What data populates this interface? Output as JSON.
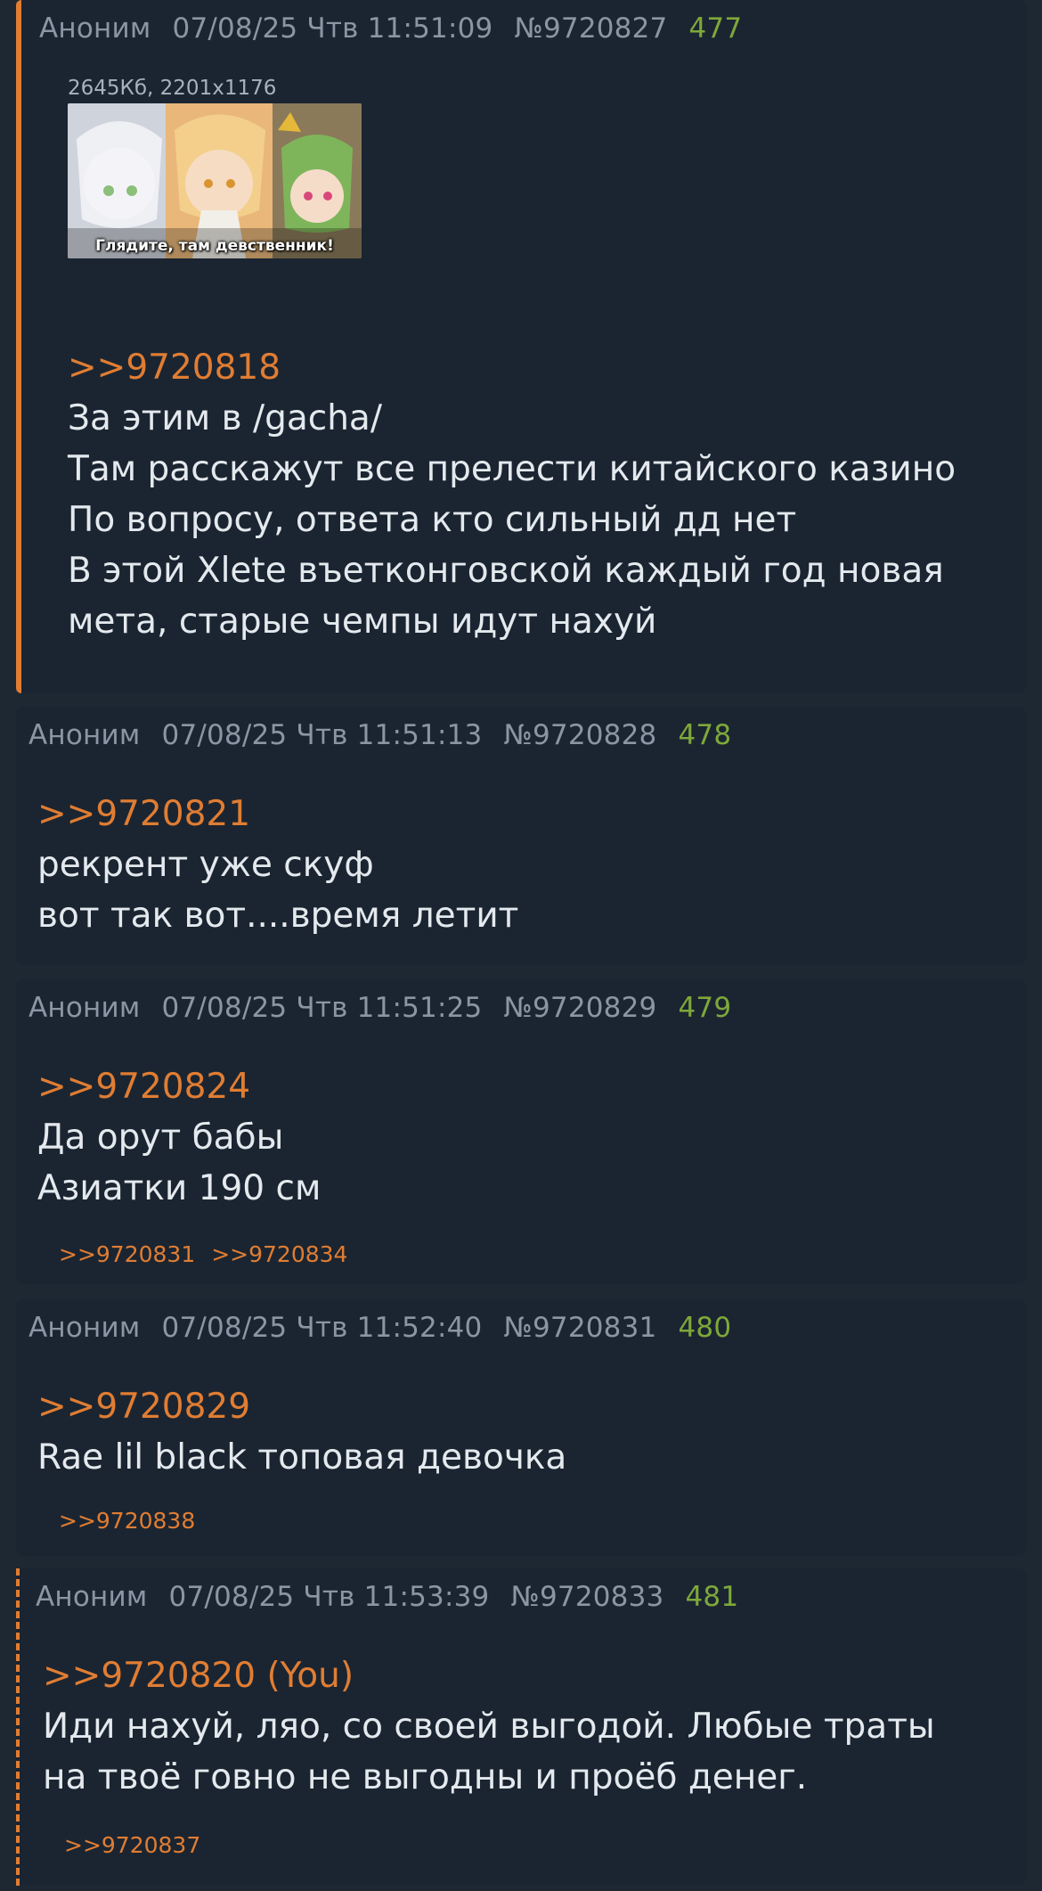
{
  "posts": [
    {
      "author": "Аноним",
      "date": "07/08/25 Чтв 11:51:09",
      "post_id": "№9720827",
      "ordinal": "477",
      "file": {
        "info": "2645Кб, 2201x1176",
        "caption": "Глядите, там девственник!"
      },
      "reply_to": ">>9720818",
      "lines": [
        "За этим в /gacha/",
        "Там расскажут все прелести китайского казино",
        "По вопросу, ответа кто сильный дд нет",
        "В этой Xlete въетконговской каждый год новая",
        "мета, старые чемпы идут нахуй"
      ]
    },
    {
      "author": "Аноним",
      "date": "07/08/25 Чтв 11:51:13",
      "post_id": "№9720828",
      "ordinal": "478",
      "reply_to": ">>9720821",
      "lines": [
        "рекрент уже скуф",
        "вот так вот....время летит"
      ]
    },
    {
      "author": "Аноним",
      "date": "07/08/25 Чтв 11:51:25",
      "post_id": "№9720829",
      "ordinal": "479",
      "reply_to": ">>9720824",
      "lines": [
        "Да орут бабы",
        "Азиатки 190 см"
      ],
      "backrefs": [
        ">>9720831",
        ">>9720834"
      ]
    },
    {
      "author": "Аноним",
      "date": "07/08/25 Чтв 11:52:40",
      "post_id": "№9720831",
      "ordinal": "480",
      "reply_to": ">>9720829",
      "lines": [
        "Rae lil black топовая девочка"
      ],
      "backrefs": [
        ">>9720838"
      ]
    },
    {
      "author": "Аноним",
      "date": "07/08/25 Чтв 11:53:39",
      "post_id": "№9720833",
      "ordinal": "481",
      "reply_to": ">>9720820 (You)",
      "lines": [
        "Иди нахуй, ляо, со своей выгодой. Любые траты",
        "на твоё говно не выгодны и проёб денег."
      ],
      "backrefs": [
        ">>9720837"
      ]
    }
  ],
  "colors": {
    "background": "#1e2833",
    "post_background": "#1b2531",
    "header_text": "#8a96a3",
    "ordinal": "#7ea83a",
    "reply_link": "#e07d33",
    "body_text": "#e4e9ee"
  }
}
